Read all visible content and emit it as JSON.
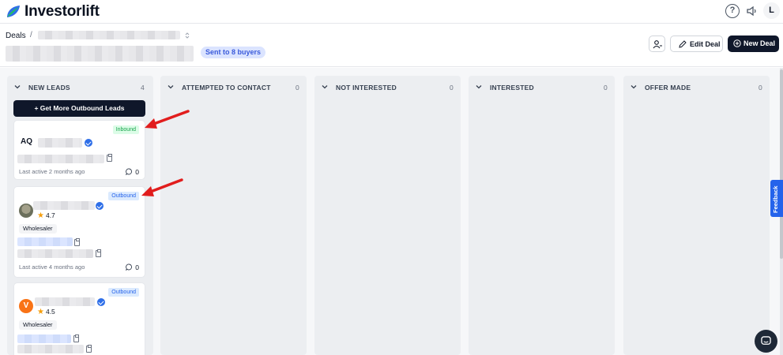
{
  "app": {
    "brand": "Investorlift",
    "user_initial": "L",
    "help_label": "?"
  },
  "breadcrumb": {
    "root": "Deals",
    "separator": "/"
  },
  "deal": {
    "status_badge": "Sent to 8 buyers"
  },
  "actions": {
    "edit_label": "Edit Deal",
    "new_label": "New Deal"
  },
  "board": {
    "get_more_label": "+ Get More Outbound Leads",
    "columns": [
      {
        "title": "NEW LEADS",
        "count": "4"
      },
      {
        "title": "ATTEMPTED TO CONTACT",
        "count": "0"
      },
      {
        "title": "NOT INTERESTED",
        "count": "0"
      },
      {
        "title": "INTERESTED",
        "count": "0"
      },
      {
        "title": "OFFER MADE",
        "count": "0"
      }
    ],
    "cards": [
      {
        "tag": "Inbound",
        "initials": "AQ",
        "last_active": "Last active 2 months ago",
        "comments": "0"
      },
      {
        "tag": "Outbound",
        "rating": "4.7",
        "role": "Wholesaler",
        "last_active": "Last active 4 months ago",
        "comments": "0"
      },
      {
        "tag": "Outbound",
        "initials": "V",
        "rating": "4.5",
        "role": "Wholesaler"
      }
    ]
  },
  "feedback": {
    "label": "Feedback"
  },
  "colors": {
    "brand_dark": "#0f172a",
    "inbound": "#16a34a",
    "outbound": "#2563eb",
    "verified": "#2f6fe8",
    "annotation_arrow": "#e11d1d",
    "badge_bg": "#dbe4ff"
  },
  "icons": [
    "leaf-logo-icon",
    "help-icon",
    "speaker-icon",
    "user-icon",
    "pencil-icon",
    "plus-circle-icon",
    "chevron-down-icon",
    "verified-icon",
    "clipboard-icon",
    "comment-icon",
    "star-icon",
    "chat-icon"
  ]
}
